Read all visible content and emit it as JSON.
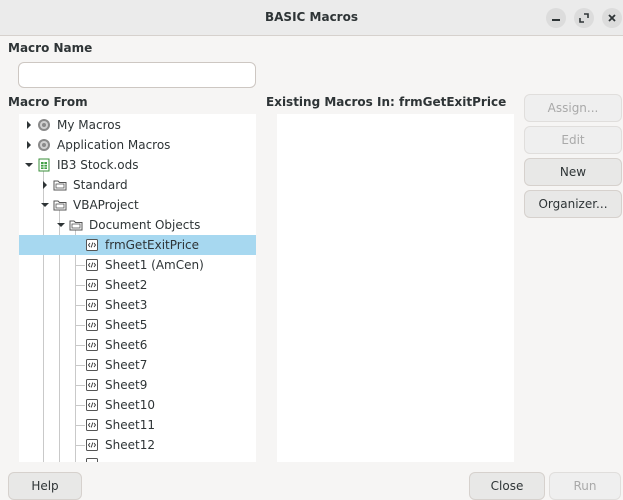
{
  "window": {
    "title": "BASIC Macros"
  },
  "macro_name": {
    "label": "Macro Name",
    "value": "",
    "placeholder": ""
  },
  "macro_from": {
    "label": "Macro From",
    "tree": [
      {
        "label": "My Macros",
        "icon": "library-icon",
        "state": "collapsed"
      },
      {
        "label": "Application Macros",
        "icon": "library-icon",
        "state": "collapsed"
      },
      {
        "label": "IB3 Stock.ods",
        "icon": "spreadsheet-icon",
        "state": "expanded"
      },
      {
        "label": "Standard",
        "icon": "folder-icon",
        "state": "collapsed"
      },
      {
        "label": "VBAProject",
        "icon": "folder-icon",
        "state": "expanded"
      },
      {
        "label": "Document Objects",
        "icon": "folder-icon",
        "state": "expanded"
      },
      {
        "label": "frmGetExitPrice",
        "icon": "module-icon",
        "selected": true
      },
      {
        "label": "Sheet1 (AmCen)",
        "icon": "module-icon"
      },
      {
        "label": "Sheet2",
        "icon": "module-icon"
      },
      {
        "label": "Sheet3",
        "icon": "module-icon"
      },
      {
        "label": "Sheet5",
        "icon": "module-icon"
      },
      {
        "label": "Sheet6",
        "icon": "module-icon"
      },
      {
        "label": "Sheet7",
        "icon": "module-icon"
      },
      {
        "label": "Sheet9",
        "icon": "module-icon"
      },
      {
        "label": "Sheet10",
        "icon": "module-icon"
      },
      {
        "label": "Sheet11",
        "icon": "module-icon"
      },
      {
        "label": "Sheet12",
        "icon": "module-icon"
      }
    ]
  },
  "existing_macros": {
    "label": "Existing Macros In: frmGetExitPrice",
    "items": []
  },
  "buttons": {
    "assign": "Assign...",
    "edit": "Edit",
    "new": "New",
    "organizer": "Organizer...",
    "help": "Help",
    "close": "Close",
    "run": "Run"
  },
  "colors": {
    "selection": "#a7d8f0",
    "background": "#f6f5f4",
    "panel": "#ffffff"
  }
}
